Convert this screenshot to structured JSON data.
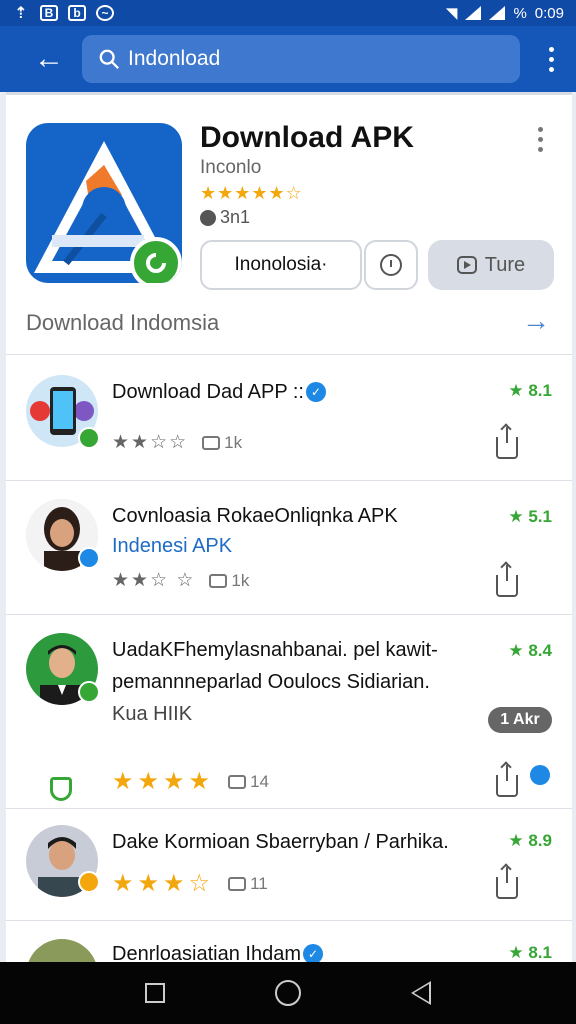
{
  "status_bar": {
    "time": "0:09",
    "battery": "%"
  },
  "search": {
    "query": "Indonload"
  },
  "hero": {
    "title": "Download APK",
    "subtitle": "Inconlo",
    "rating_text": "★★★★★☆",
    "meta": "3n1",
    "btn_lang": "Inonolosia·",
    "btn_tune": "Ture",
    "link_text": "Download Indomsia"
  },
  "list": [
    {
      "title": "Download Dad APP ::",
      "score": "★ 8.1",
      "count": "1k",
      "stars": "★★☆☆"
    },
    {
      "title": "Covnloasia RokaeOnliqnka APK",
      "sub": "Indenesi APK",
      "score": "★ 5.1",
      "count": "1k",
      "stars": "★★☆ ☆"
    },
    {
      "title": "UadaKFhemylasnahbanai. pel kawit-",
      "line2": "pemannneparlad Ooulocs Sidiarian.",
      "line3": "Kua HIIK",
      "ad": "1 Akr",
      "score": "★ 8.4",
      "count": "14",
      "stars": "★★★★"
    },
    {
      "title": "Dake Kormioan Sbaerryban / Parhika.",
      "score": "★ 8.9",
      "count": "11",
      "stars": "★★★☆"
    },
    {
      "title": "Denrloasiatian Ihdam",
      "score": "★ 8.1"
    }
  ],
  "colors": {
    "primary": "#1557b8",
    "accent_green": "#36a634",
    "star_gold": "#f3a70d"
  }
}
